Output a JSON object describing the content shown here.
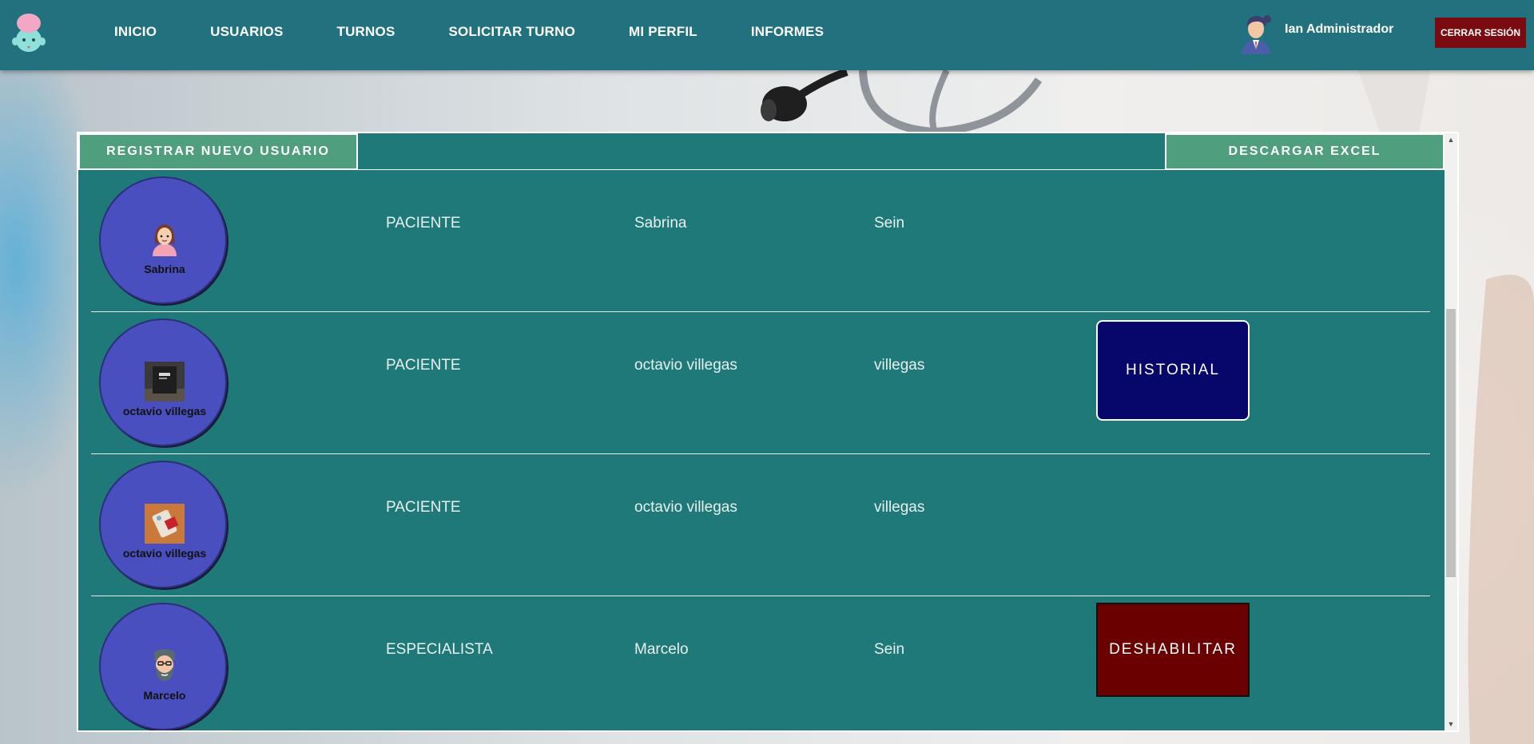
{
  "nav": {
    "links": [
      "INICIO",
      "USUARIOS",
      "TURNOS",
      "SOLICITAR TURNO",
      "MI PERFIL",
      "INFORMES"
    ],
    "user_name": "Ian Administrador",
    "logout_label": "CERRAR SESIÓN"
  },
  "panel": {
    "register_label": "REGISTRAR NUEVO USUARIO",
    "excel_label": "DESCARGAR EXCEL"
  },
  "users": [
    {
      "avatar_name": "Sabrina",
      "role": "PACIENTE",
      "first_name": "Sabrina",
      "last_name": "Sein",
      "avatar_icon": "woman-avatar-icon"
    },
    {
      "avatar_name": "octavio villegas",
      "role": "PACIENTE",
      "first_name": "octavio villegas",
      "last_name": "villegas",
      "avatar_icon": "photo-avatar-icon",
      "action_label": "HISTORIAL"
    },
    {
      "avatar_name": "octavio villegas",
      "role": "PACIENTE",
      "first_name": "octavio villegas",
      "last_name": "villegas",
      "avatar_icon": "photo-avatar-icon"
    },
    {
      "avatar_name": "Marcelo",
      "role": "ESPECIALISTA",
      "first_name": "Marcelo",
      "last_name": "Sein",
      "avatar_icon": "bearded-man-avatar-icon",
      "action_label": "DESHABILITAR"
    }
  ],
  "colors": {
    "navbar": "#22717e",
    "panel": "#207979",
    "button_green": "#4f9f7f",
    "historial": "#07076b",
    "disable": "#6b0000",
    "logout": "#7a0b10",
    "avatar_circle": "#4a4fbf"
  }
}
